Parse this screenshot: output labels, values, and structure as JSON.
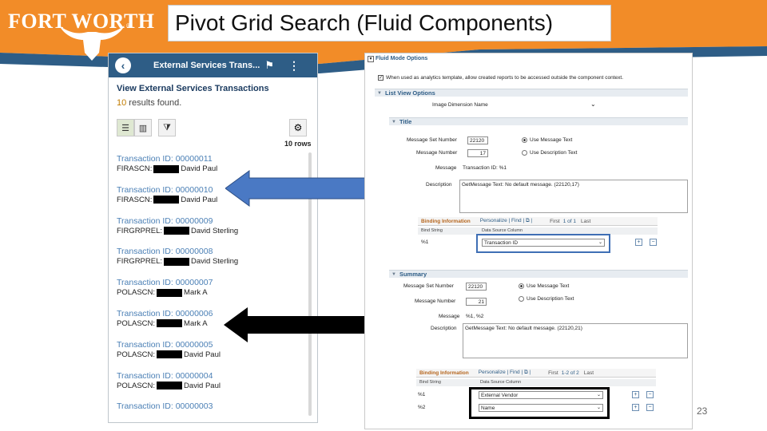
{
  "slide": {
    "logo_text": "FORT WORTH",
    "logo_reg": "®",
    "title": "Pivot Grid Search (Fluid Components)",
    "page_number": "23"
  },
  "mobile": {
    "header_title": "External Services Trans...",
    "back_glyph": "‹",
    "flag_icon": "⚑",
    "kebab_icon": "⋮",
    "heading": "View External Services Transactions",
    "results_count": "10",
    "results_suffix": " results found.",
    "list_icon": "☰",
    "chart_icon": "▥",
    "filter_icon": "⧩",
    "gear_icon": "⚙",
    "rows_label": "10 rows",
    "transactions": [
      {
        "id": "Transaction ID: 00000011",
        "label": "FIRASCN:",
        "name": "David Paul"
      },
      {
        "id": "Transaction ID: 00000010",
        "label": "FIRASCN:",
        "name": "David Paul"
      },
      {
        "id": "Transaction ID: 00000009",
        "label": "FIRGRPREL:",
        "name": "David Sterling"
      },
      {
        "id": "Transaction ID: 00000008",
        "label": "FIRGRPREL:",
        "name": "David Sterling"
      },
      {
        "id": "Transaction ID: 00000007",
        "label": "POLASCN:",
        "name": "Mark A"
      },
      {
        "id": "Transaction ID: 00000006",
        "label": "POLASCN:",
        "name": "Mark A"
      },
      {
        "id": "Transaction ID: 00000005",
        "label": "POLASCN:",
        "name": "David Paul"
      },
      {
        "id": "Transaction ID: 00000004",
        "label": "POLASCN:",
        "name": "David Paul"
      },
      {
        "id": "Transaction ID: 00000003",
        "label": "",
        "name": ""
      }
    ]
  },
  "config": {
    "fluid_mode_options": "Fluid Mode Options",
    "analytics_checkbox": "When used as analytics template, allow created reports to be accessed outside the component context.",
    "list_view_options": "List View Options",
    "image_dimension_label": "Image Dimension Name",
    "title_section": {
      "label": "Title",
      "msg_set_label": "Message Set Number",
      "msg_set_value": "22120",
      "msg_num_label": "Message Number",
      "msg_num_value": "17",
      "use_message_text": "Use Message Text",
      "use_description_text": "Use Description Text",
      "message_label": "Message",
      "message_value": "Transaction ID: %1",
      "description_label": "Description",
      "description_value": "GetMessage Text: No default message. (22120,17)"
    },
    "binding1": {
      "title": "Binding Information",
      "personalize": "Personalize | Find | ⧉ |",
      "first": "First",
      "range": "1 of 1",
      "last": "Last",
      "col_bind": "Bind String",
      "col_source": "Data Source Column",
      "rows": [
        {
          "bind": "%1",
          "source": "Transaction ID"
        }
      ]
    },
    "summary_section": {
      "label": "Summary",
      "msg_set_label": "Message Set Number",
      "msg_set_value": "22120",
      "msg_num_label": "Message Number",
      "msg_num_value": "21",
      "use_message_text": "Use Message Text",
      "use_description_text": "Use Description Text",
      "message_label": "Message",
      "message_value": "%1, %2",
      "description_label": "Description",
      "description_value": "GetMessage Text: No default message. (22120,21)"
    },
    "binding2": {
      "title": "Binding Information",
      "personalize": "Personalize | Find | ⧉ |",
      "first": "First",
      "range": "1-2 of 2",
      "last": "Last",
      "col_bind": "Bind String",
      "col_source": "Data Source Column",
      "rows": [
        {
          "bind": "%1",
          "source": "External Vendor"
        },
        {
          "bind": "%2",
          "source": "Name"
        }
      ]
    },
    "plus": "+",
    "minus": "−"
  },
  "colors": {
    "orange": "#f28c28",
    "blue_band": "#2e5d86",
    "arrow_blue": "#4a79c4",
    "arrow_black": "#000000"
  }
}
